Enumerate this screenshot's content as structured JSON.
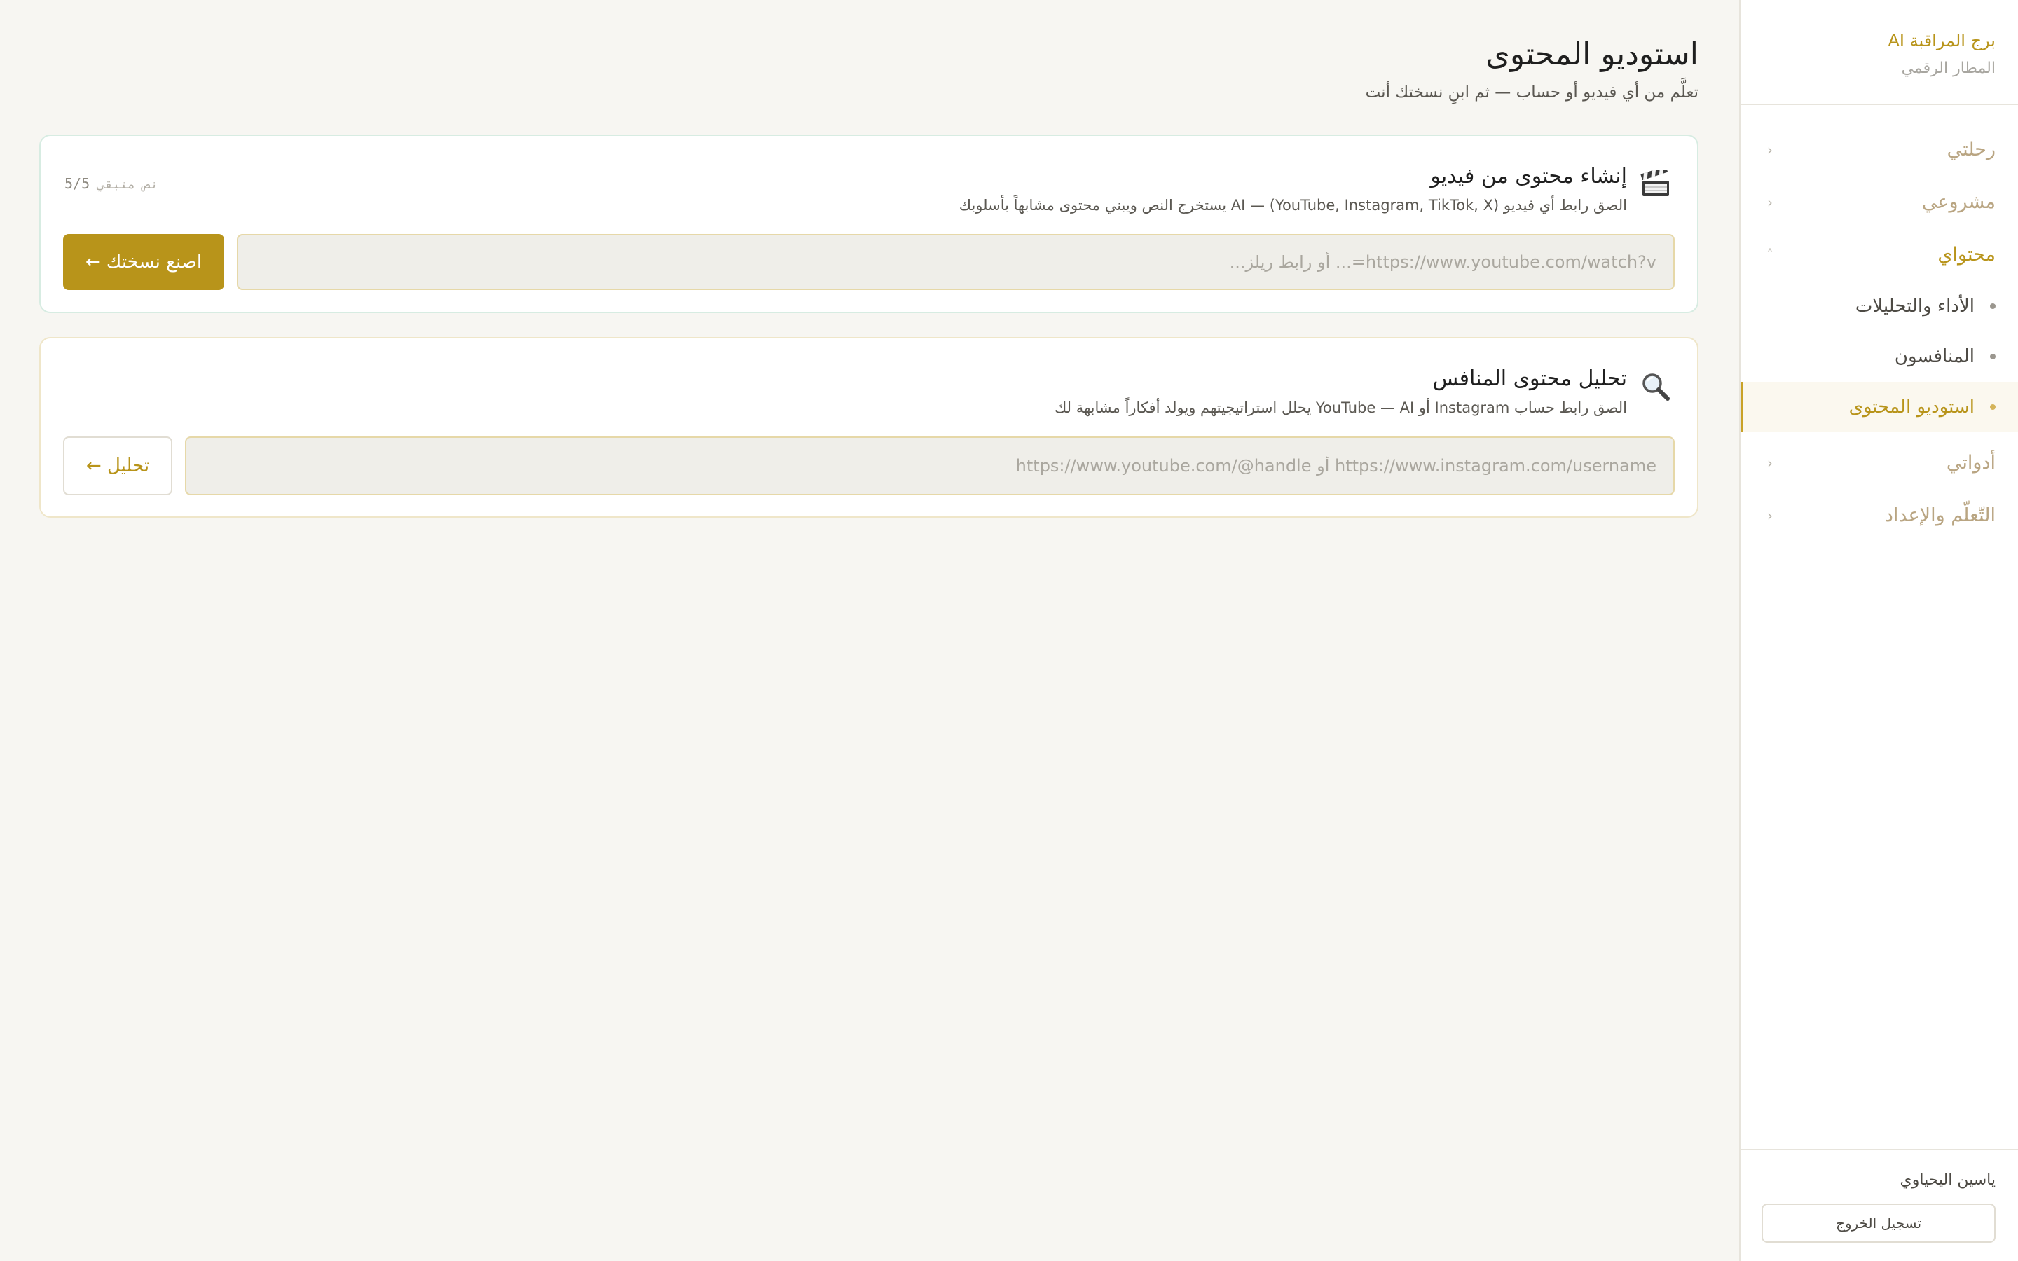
{
  "brand": {
    "title": "برج المراقبة AI",
    "subtitle": "المطار الرقمي"
  },
  "nav": {
    "groups": [
      {
        "label": "رحلتي",
        "chevron": "‹"
      },
      {
        "label": "مشروعي",
        "chevron": "‹"
      },
      {
        "label": "محتواي",
        "chevron": "˄"
      },
      {
        "label": "أدواتي",
        "chevron": "‹"
      },
      {
        "label": "التّعلّم والإعداد",
        "chevron": "‹"
      }
    ],
    "content_items": [
      {
        "label": "الأداء والتحليلات"
      },
      {
        "label": "المنافسون"
      },
      {
        "label": "استوديو المحتوى"
      }
    ]
  },
  "user": {
    "name": "ياسين اليحياوي",
    "logout_label": "تسجيل الخروج"
  },
  "page": {
    "title": "استوديو المحتوى",
    "subtitle": "تعلَّم من أي فيديو أو حساب — ثم ابنِ نسختك أنت"
  },
  "video_card": {
    "title": "إنشاء محتوى من فيديو",
    "description": "الصق رابط أي فيديو (YouTube, Instagram, TikTok, X) — AI يستخرج النص ويبني محتوى مشابهاً بأسلوبك",
    "quota_count": "5/5",
    "quota_label": "نص متبقي",
    "input_placeholder": "https://www.youtube.com/watch?v=... أو رابط ريلز...",
    "button_label": "اصنع نسختك ←",
    "icon": "clapperboard-icon"
  },
  "competitor_card": {
    "title": "تحليل محتوى المنافس",
    "description": "الصق رابط حساب Instagram أو YouTube — AI يحلل استراتيجيتهم ويولد أفكاراً مشابهة لك",
    "input_placeholder": "https://www.instagram.com/username أو https://www.youtube.com/@handle",
    "button_label": "تحليل ←",
    "icon": "magnifier-icon"
  },
  "colors": {
    "accent": "#b8941a",
    "background": "#f7f6f2",
    "card_border_green": "#d7ece2",
    "card_border_gold": "#efe6c9"
  }
}
